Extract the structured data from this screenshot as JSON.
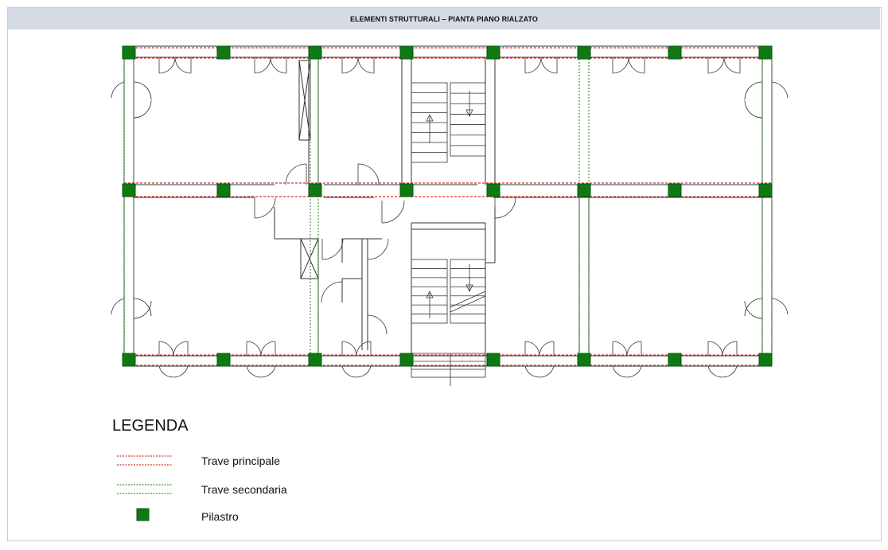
{
  "title": "ELEMENTI STRUTTURALI – PIANTA PIANO RIALZATO",
  "legend": {
    "title": "LEGENDA",
    "items": [
      {
        "id": "trave-principale",
        "label": "Trave principale",
        "color": "#e0302a",
        "style": "double-dotted-line"
      },
      {
        "id": "trave-secondaria",
        "label": "Trave secondaria",
        "color": "#3a9a3a",
        "style": "double-dotted-line"
      },
      {
        "id": "pilastro",
        "label": "Pilastro",
        "color": "#0f7a14",
        "style": "filled-square"
      }
    ]
  },
  "colors": {
    "wall": "#333333",
    "main_beam": "#e0302a",
    "secondary_beam": "#3a9a3a",
    "pillar": "#0f7a14",
    "pillar_stroke": "#0a5410",
    "title_bg": "#d4dbe4"
  }
}
